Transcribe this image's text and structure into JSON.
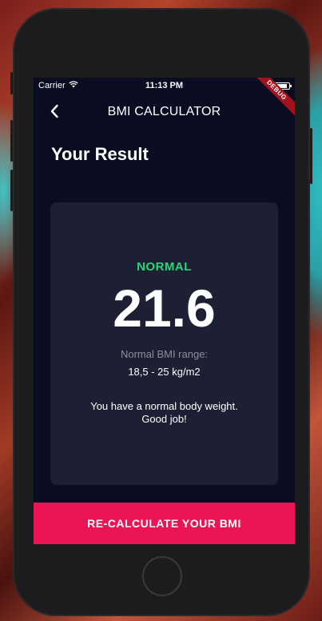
{
  "status_bar": {
    "carrier": "Carrier",
    "time": "11:13 PM"
  },
  "debug_banner": "DEBUG",
  "app_bar": {
    "back_icon": "chevron-left-icon",
    "title": "BMI CALCULATOR"
  },
  "page": {
    "heading": "Your Result"
  },
  "result": {
    "category": "NORMAL",
    "bmi": "21.6",
    "range_label": "Normal BMI range:",
    "range_value": "18,5 - 25 kg/m2",
    "interpretation": "You have a normal body weight. Good job!"
  },
  "actions": {
    "recalculate_label": "RE-CALCULATE YOUR BMI"
  },
  "colors": {
    "background": "#0a0c21",
    "card": "#1d1f33",
    "accent": "#eb1555",
    "normal": "#24d876",
    "muted_text": "#8d8e98"
  }
}
